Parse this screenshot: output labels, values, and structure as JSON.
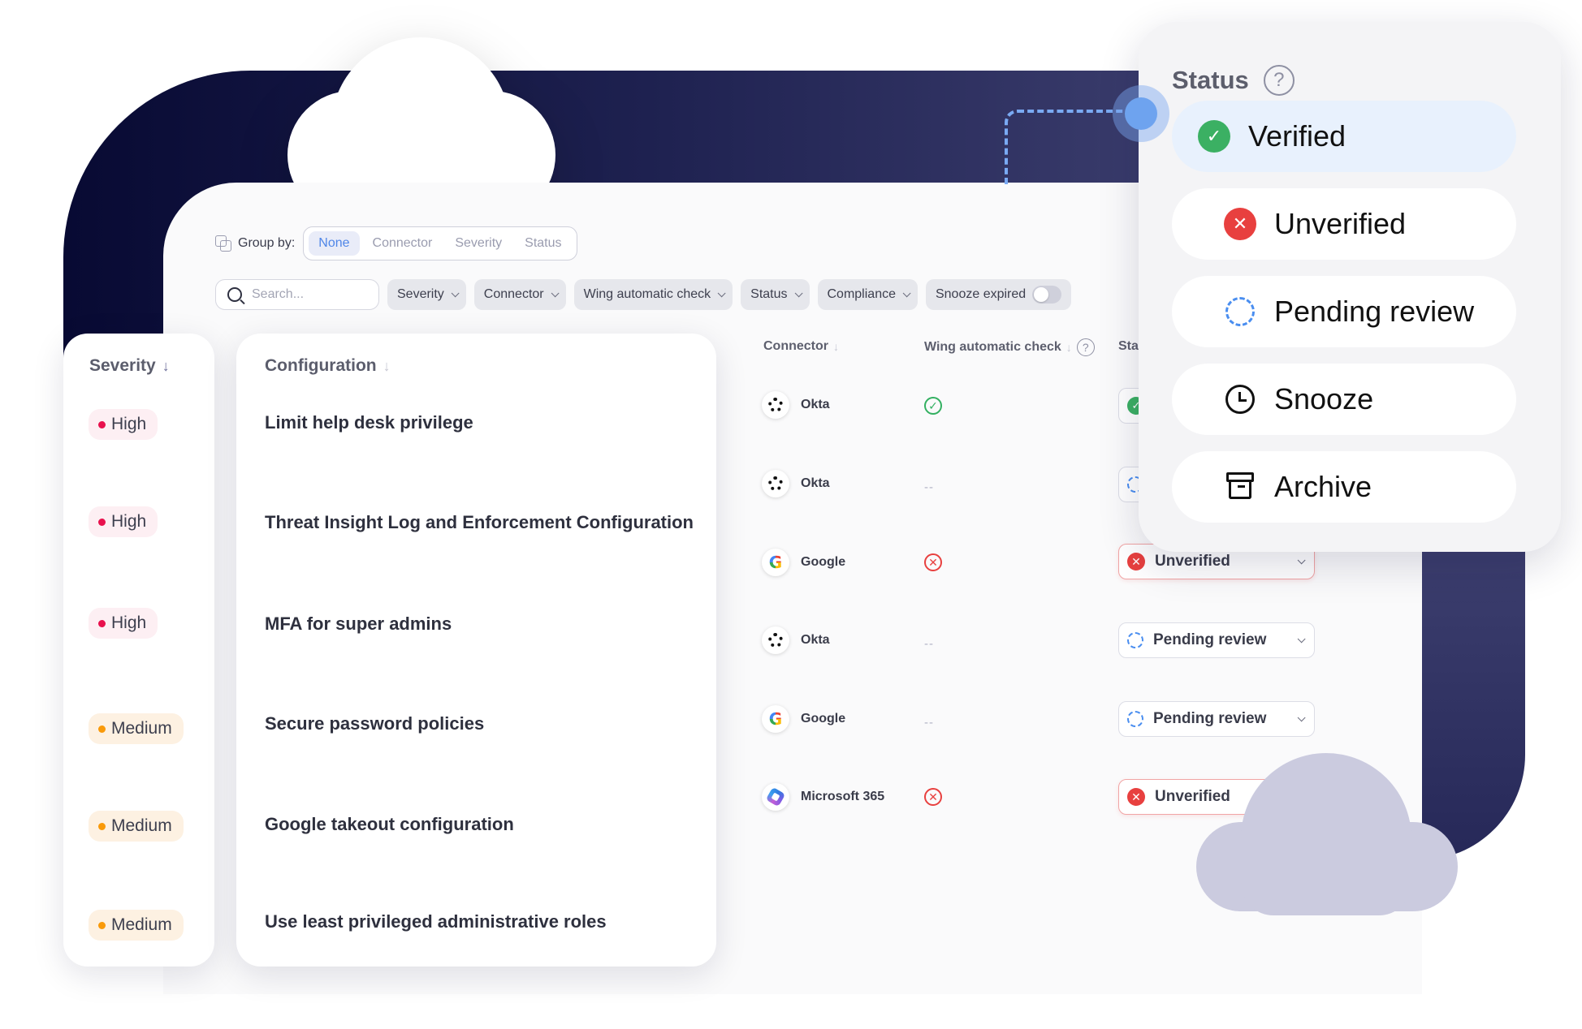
{
  "groupby": {
    "label": "Group by:",
    "options": [
      "None",
      "Connector",
      "Severity",
      "Status"
    ],
    "selected": "None"
  },
  "filters": {
    "search_placeholder": "Search...",
    "chips": [
      "Severity",
      "Connector",
      "Wing automatic check",
      "Status",
      "Compliance"
    ],
    "toggle_label": "Snooze expired",
    "toggle_on": false
  },
  "table": {
    "headers": {
      "severity": "Severity",
      "configuration": "Configuration",
      "connector": "Connector",
      "wing_check": "Wing automatic check",
      "status": "Sta"
    },
    "rows": [
      {
        "severity": "High",
        "configuration": "Limit help desk privilege",
        "connector": "Okta",
        "connector_icon": "okta-icon",
        "wing_check": "pass",
        "status": "Verified"
      },
      {
        "severity": "High",
        "configuration": "Threat Insight Log and Enforcement Configuration",
        "connector": "Okta",
        "connector_icon": "okta-icon",
        "wing_check": "--",
        "status": "Pending review"
      },
      {
        "severity": "High",
        "configuration": "MFA for super admins",
        "connector": "Google",
        "connector_icon": "google-icon",
        "wing_check": "fail",
        "status": "Unverified"
      },
      {
        "severity": "Medium",
        "configuration": "Secure password policies",
        "connector": "Okta",
        "connector_icon": "okta-icon",
        "wing_check": "--",
        "status": "Pending review"
      },
      {
        "severity": "Medium",
        "configuration": "Google takeout configuration",
        "connector": "Google",
        "connector_icon": "google-icon",
        "wing_check": "--",
        "status": "Pending review"
      },
      {
        "severity": "Medium",
        "configuration": "Use least privileged administrative roles",
        "connector": "Microsoft 365",
        "connector_icon": "microsoft-365-icon",
        "wing_check": "fail",
        "status": "Unverified"
      }
    ],
    "dash": "--"
  },
  "status_popup": {
    "title": "Status",
    "help": "?",
    "options": [
      {
        "label": "Verified",
        "icon": "check-circle-icon",
        "selected": true
      },
      {
        "label": "Unverified",
        "icon": "x-circle-icon",
        "selected": false
      },
      {
        "label": "Pending review",
        "icon": "dashed-circle-icon",
        "selected": false
      },
      {
        "label": "Snooze",
        "icon": "clock-icon",
        "selected": false
      },
      {
        "label": "Archive",
        "icon": "archive-icon",
        "selected": false
      }
    ]
  },
  "colors": {
    "navy": "#080a33",
    "accent_blue": "#4f86e8",
    "verified_green": "#3bb063",
    "unverified_red": "#e8403f",
    "high": "#e8114d",
    "medium": "#f99a0a"
  }
}
